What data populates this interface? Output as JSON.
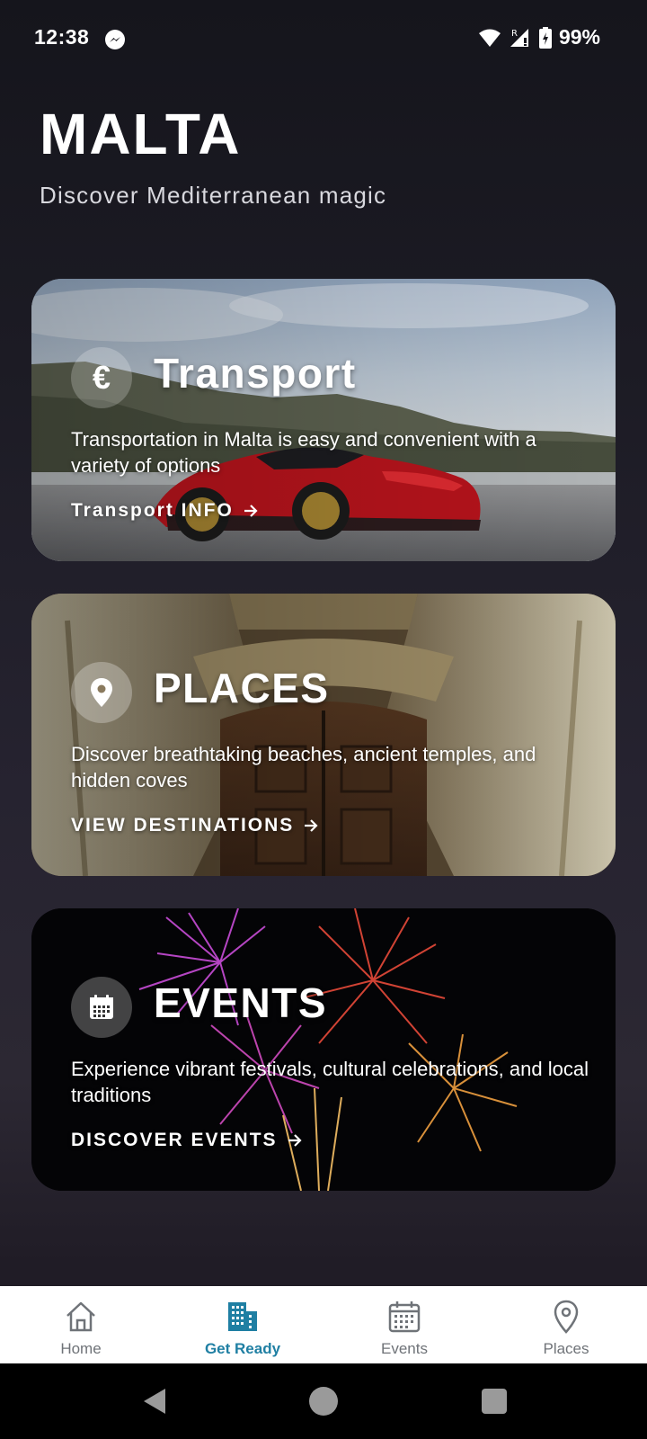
{
  "status_bar": {
    "time": "12:38",
    "battery": "99%",
    "icons": [
      "messenger-icon",
      "wifi-icon",
      "signal-icon",
      "battery-icon"
    ]
  },
  "header": {
    "title": "MALTA",
    "subtitle": "Discover Mediterranean magic"
  },
  "cards": [
    {
      "title": "Transport",
      "description": "Transportation in Malta is easy and convenient with a variety of options",
      "link": "Transport INFO",
      "icon": "euro-icon",
      "icon_glyph": "€"
    },
    {
      "title": "PLACES",
      "description": "Discover breathtaking beaches, ancient temples, and hidden coves",
      "link": "VIEW DESTINATIONS",
      "icon": "location-pin-icon"
    },
    {
      "title": "EVENTS",
      "description": "Experience vibrant festivals, cultural celebrations, and local traditions",
      "link": "DISCOVER EVENTS",
      "icon": "calendar-icon"
    }
  ],
  "bottom_nav": {
    "items": [
      {
        "label": "Home",
        "icon": "home-icon",
        "active": false
      },
      {
        "label": "Get Ready",
        "icon": "buildings-icon",
        "active": true
      },
      {
        "label": "Events",
        "icon": "calendar-icon",
        "active": false
      },
      {
        "label": "Places",
        "icon": "location-pin-icon",
        "active": false
      }
    ],
    "active_color": "#1f7fa3",
    "inactive_color": "#6f7378"
  },
  "system_nav": {
    "buttons": [
      "back-button",
      "home-button",
      "recents-button"
    ]
  }
}
